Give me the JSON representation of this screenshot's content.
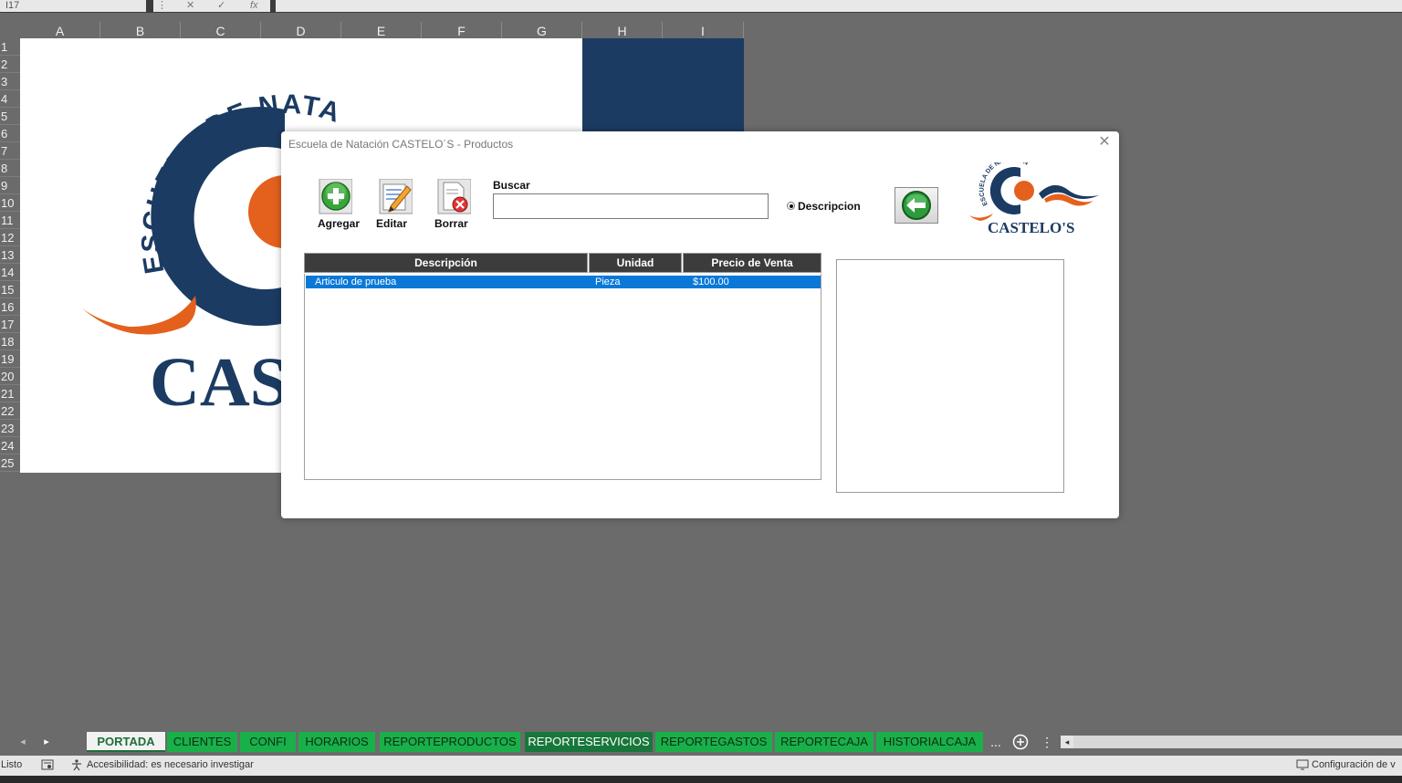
{
  "formula_bar": {
    "name_box": "I17",
    "fx_label": "fx"
  },
  "columns": [
    "A",
    "B",
    "C",
    "D",
    "E",
    "F",
    "G",
    "H",
    "I"
  ],
  "rows": [
    "1",
    "2",
    "3",
    "4",
    "5",
    "6",
    "7",
    "8",
    "9",
    "10",
    "11",
    "12",
    "13",
    "14",
    "15",
    "16",
    "17",
    "18",
    "19",
    "20",
    "21",
    "22",
    "23",
    "24",
    "25"
  ],
  "sheet_logo": {
    "arc_text": "ESCUELA DE NATACIÓN",
    "brand_text": "CAST"
  },
  "colors": {
    "navy": "#1b3b62",
    "orange": "#e4601d",
    "tab_green": "#19b04a",
    "selection_blue": "#0a78d7"
  },
  "dialog": {
    "title": "Escuela de Natación CASTELO´S - Productos",
    "toolbar": {
      "add_label": "Agregar",
      "edit_label": "Editar",
      "delete_label": "Borrar"
    },
    "search": {
      "label": "Buscar",
      "value": ""
    },
    "radio": {
      "label": "Descripcion",
      "checked": true
    },
    "logo": {
      "arc_text": "ESCUELA DE NATACIÓN",
      "brand_text": "CASTELO'S"
    },
    "list": {
      "headers": {
        "description": "Descripción",
        "unit": "Unidad",
        "price": "Precio de Venta"
      },
      "rows": [
        {
          "description": "Articulo de prueba",
          "unit": "Pieza",
          "price": "$100.00"
        }
      ]
    }
  },
  "tabs": [
    {
      "label": "PORTADA",
      "state": "active"
    },
    {
      "label": "CLIENTES",
      "state": "normal"
    },
    {
      "label": "CONFI",
      "state": "normal"
    },
    {
      "label": "HORARIOS",
      "state": "normal"
    },
    {
      "label": "REPORTEPRODUCTOS",
      "state": "normal"
    },
    {
      "label": "REPORTESERVICIOS",
      "state": "dark"
    },
    {
      "label": "REPORTEGASTOS",
      "state": "normal"
    },
    {
      "label": "REPORTECAJA",
      "state": "normal"
    },
    {
      "label": "HISTORIALCAJA",
      "state": "normal"
    }
  ],
  "tab_more": "...",
  "status": {
    "ready": "Listo",
    "accessibility": "Accesibilidad: es necesario investigar",
    "display_settings": "Configuración de v"
  }
}
